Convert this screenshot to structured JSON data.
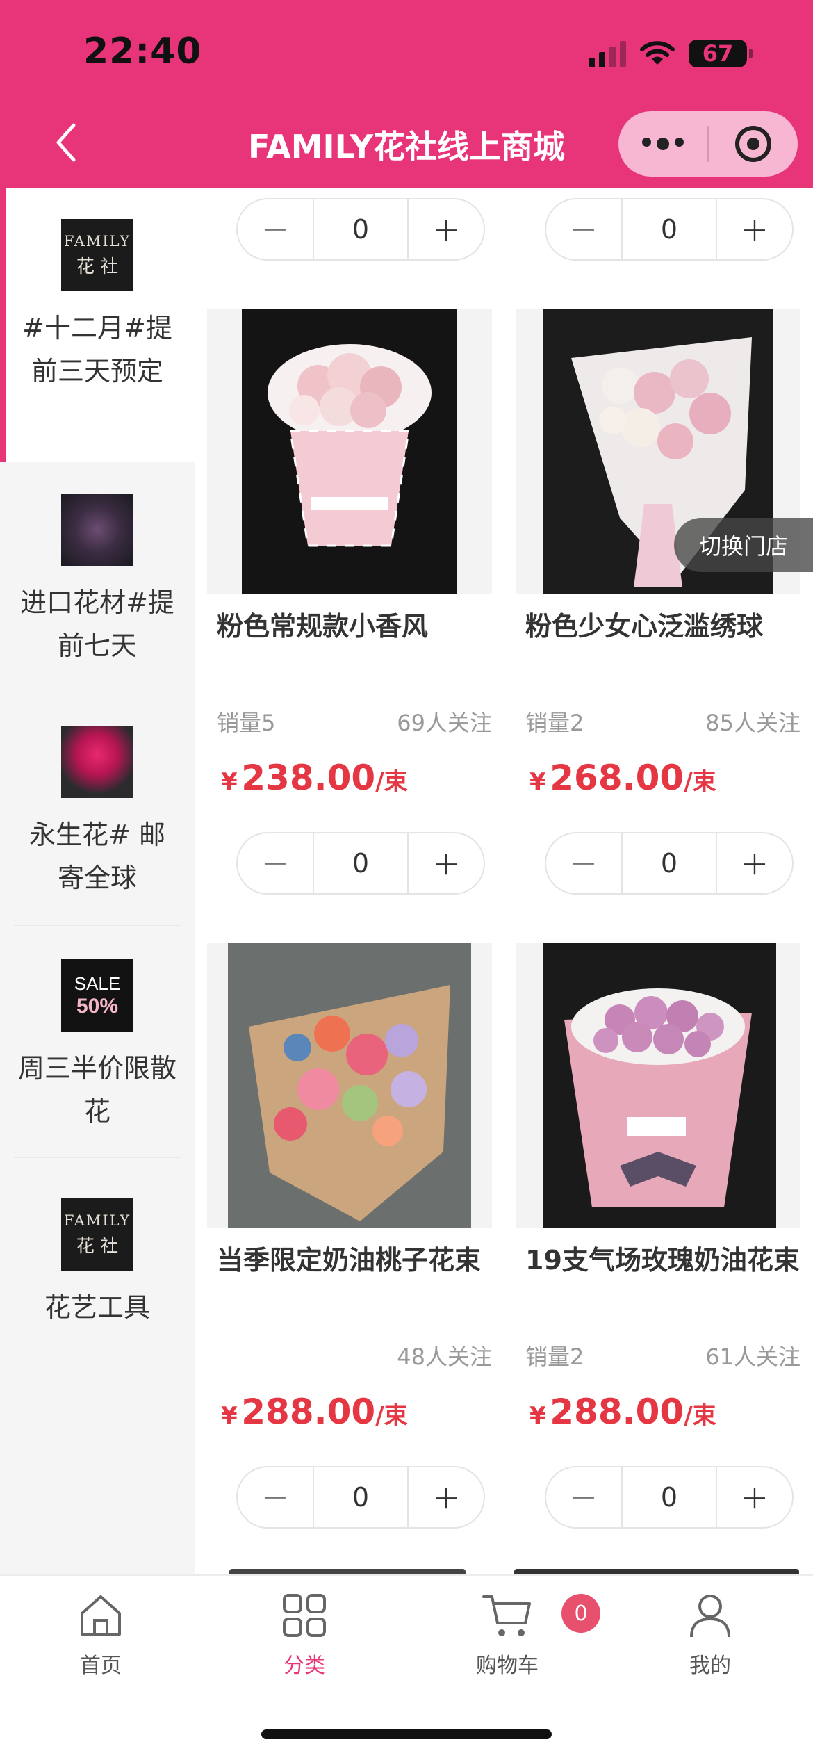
{
  "status_bar": {
    "time": "22:40",
    "battery": "67"
  },
  "header": {
    "title": "FAMILY花社线上商城"
  },
  "sidebar": {
    "items": [
      {
        "label": "#十二月#提前三天预定",
        "thumb_text_1": "FAMILY",
        "thumb_text_2": "花 社"
      },
      {
        "label": "进口花材#提前七天"
      },
      {
        "label": "永生花# 邮寄全球"
      },
      {
        "label": "周三半价限散花",
        "thumb_text_1": "SALE",
        "thumb_text_2": "50%"
      },
      {
        "label": "花艺工具",
        "thumb_text_1": "FAMILY",
        "thumb_text_2": "花 社"
      }
    ]
  },
  "switch_store": "切换门店",
  "stepper": {
    "minus": "−",
    "plus": "+"
  },
  "top_steppers": [
    {
      "qty": "0"
    },
    {
      "qty": "0"
    }
  ],
  "products": [
    {
      "name": "粉色常规款小香风",
      "sales": "销量5",
      "followers": "69人关注",
      "currency": "¥",
      "price": "238.00",
      "unit": "/束",
      "qty": "0"
    },
    {
      "name": "粉色少女心泛滥绣球",
      "sales": "销量2",
      "followers": "85人关注",
      "currency": "¥",
      "price": "268.00",
      "unit": "/束",
      "qty": "0"
    },
    {
      "name": "当季限定奶油桃子花束",
      "sales": "",
      "followers": "48人关注",
      "currency": "¥",
      "price": "288.00",
      "unit": "/束",
      "qty": "0"
    },
    {
      "name": "19支气场玫瑰奶油花束",
      "sales": "销量2",
      "followers": "61人关注",
      "currency": "¥",
      "price": "288.00",
      "unit": "/束",
      "qty": "0"
    }
  ],
  "tabbar": {
    "items": [
      {
        "label": "首页",
        "icon": "home-icon"
      },
      {
        "label": "分类",
        "icon": "grid-icon"
      },
      {
        "label": "购物车",
        "icon": "cart-icon"
      },
      {
        "label": "我的",
        "icon": "user-icon"
      }
    ],
    "cart_badge": "0"
  },
  "colors": {
    "brand": "#e8357a",
    "price": "#e53743",
    "badge": "#e8516d"
  }
}
